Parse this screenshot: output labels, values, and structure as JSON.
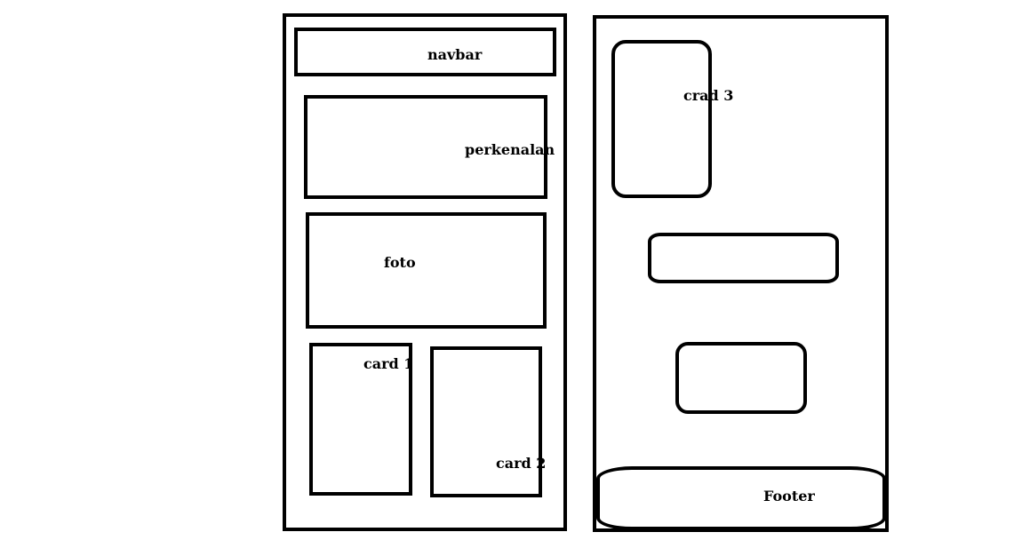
{
  "left_page": {
    "navbar_label": "navbar",
    "intro_label": "perkenalan",
    "photo_label": "foto",
    "card1_label": "card 1",
    "card2_label": "card 2"
  },
  "right_page": {
    "card3_label": "crad 3",
    "footer_label": "Footer"
  }
}
